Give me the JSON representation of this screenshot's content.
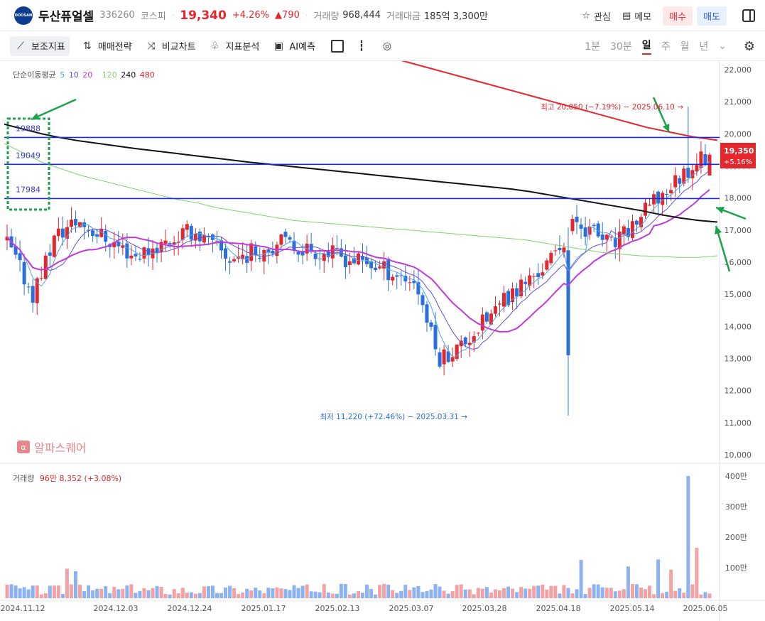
{
  "header": {
    "logo_text": "DOOSAN",
    "title": "두산퓨얼셀",
    "code": "336260",
    "market": "코스피",
    "price": "19,340",
    "change_pct": "+4.26%",
    "change_abs": "▲790",
    "volume_label": "거래량",
    "volume_value": "968,444",
    "amount_label": "거래대금",
    "amount_value": "185억 3,300만",
    "watch_label": "관심",
    "memo_label": "메모",
    "buy_label": "매수",
    "sell_label": "매도"
  },
  "toolbar": {
    "items": [
      "보조지표",
      "매매전략",
      "비교차트",
      "지표분석",
      "AI예측"
    ],
    "timeframes": [
      "1분",
      "30분",
      "일",
      "주",
      "월",
      "년"
    ],
    "active_timeframe": "일"
  },
  "legend": {
    "label": "단순이동평균",
    "periods": [
      "5",
      "10",
      "20",
      "120",
      "240",
      "480"
    ],
    "colors": [
      "#4aa8e8",
      "#6a4fd8",
      "#c03ad8",
      "#7fd36b",
      "#111111",
      "#e4262d"
    ]
  },
  "brand": "알파스퀘어",
  "brand_icon": "α",
  "volume_legend": {
    "label": "거래량",
    "value": "96만 8,352 (+3.08%)"
  },
  "colors": {
    "up": "#e4262d",
    "down": "#2a6fdb",
    "level_line": "#1f2bd6",
    "annotation_arrow": "#1aa34a"
  },
  "chart_data": {
    "type": "candlestick",
    "y_ticks": [
      "22,000",
      "21,000",
      "20,000",
      "19,000",
      "18,000",
      "17,000",
      "16,000",
      "15,000",
      "14,000",
      "13,000",
      "12,000",
      "11,000",
      "10,000"
    ],
    "ylim": [
      10000,
      22200
    ],
    "x_ticks": [
      "2024.11.12",
      "2024.12.03",
      "2024.12.24",
      "2025.01.17",
      "2025.02.13",
      "2025.03.07",
      "2025.03.28",
      "2025.04.18",
      "2025.05.14",
      "2025.06.05"
    ],
    "volume_ticks": [
      "400만",
      "300만",
      "200만",
      "100만"
    ],
    "volume_max": 4000000,
    "horizontal_levels": [
      19888,
      19049,
      17984
    ],
    "level_labels": [
      "19888",
      "19049",
      "17984"
    ],
    "max_annotation": "최고 20,850 (−7.19%) − 2025.06.10 →",
    "min_annotation": "최저 11,220 (+72.46%) − 2025.03.31 →",
    "max_value": 20850,
    "min_value": 11220,
    "current_price_tag": "19,350",
    "current_change_tag": "+5.16%",
    "current_price": 19350,
    "ma_120": [
      19700,
      19400,
      19100,
      18900,
      18700,
      18550,
      18400,
      18250,
      18100,
      17950,
      17850,
      17700,
      17600,
      17500,
      17400,
      17300,
      17250,
      17200,
      17150,
      17100,
      17050,
      17000,
      16950,
      16900,
      16850,
      16800,
      16750,
      16700,
      16600,
      16500,
      16400,
      16300,
      16250,
      16200,
      16180,
      16150,
      16150,
      16200
    ],
    "ma_240": [
      20300,
      20150,
      20000,
      19880,
      19780,
      19700,
      19620,
      19540,
      19470,
      19400,
      19330,
      19260,
      19190,
      19120,
      19060,
      19000,
      18940,
      18880,
      18820,
      18760,
      18700,
      18640,
      18580,
      18520,
      18460,
      18400,
      18340,
      18280,
      18200,
      18100,
      18000,
      17900,
      17800,
      17700,
      17600,
      17480,
      17380,
      17300,
      17250
    ],
    "ma_480": [
      22800,
      22600,
      22400,
      22200,
      22000,
      21800,
      21600,
      21400,
      21200,
      21000,
      20800,
      20600,
      20400,
      20200,
      20050,
      19900,
      19800
    ]
  }
}
